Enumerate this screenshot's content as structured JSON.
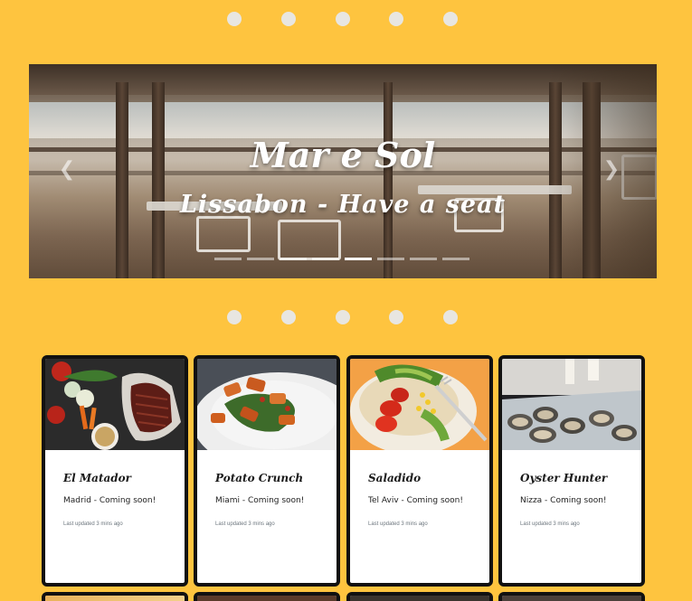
{
  "carousel": {
    "title": "Mar e Sol",
    "subtitle": "Lissabon - Have a seat",
    "prev_icon": "chevron-left-icon",
    "next_icon": "chevron-right-icon",
    "prev_glyph": "❮",
    "next_glyph": "❯",
    "indicator_count": 8,
    "active_indicator": 4
  },
  "decor_dots": {
    "count": 5,
    "color": "#e8e6e1"
  },
  "cards": [
    {
      "title": "El Matador",
      "text": "Madrid - Coming soon!",
      "updated": "Last updated 3 mins ago",
      "image": "steak-vegetables-photo"
    },
    {
      "title": "Potato Crunch",
      "text": "Miami - Coming soon!",
      "updated": "Last updated 3 mins ago",
      "image": "crispy-salad-photo"
    },
    {
      "title": "Saladido",
      "text": "Tel Aviv - Coming soon!",
      "updated": "Last updated 3 mins ago",
      "image": "avocado-tomato-salad-photo"
    },
    {
      "title": "Oyster Hunter",
      "text": "Nizza - Coming soon!",
      "updated": "Last updated 3 mins ago",
      "image": "oyster-platter-photo"
    }
  ],
  "colors": {
    "background": "#fec43f",
    "card_border": "#111111"
  }
}
